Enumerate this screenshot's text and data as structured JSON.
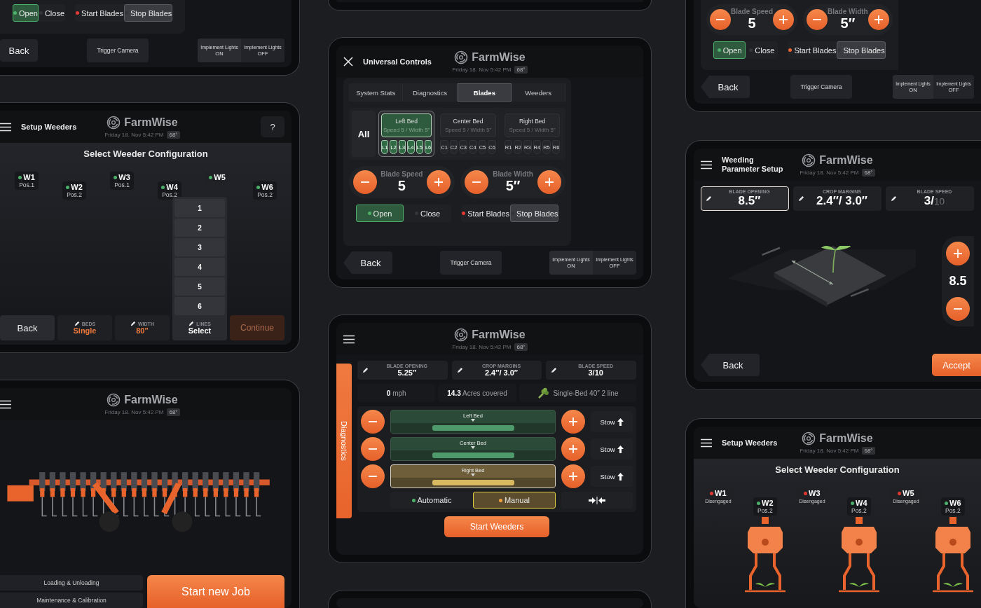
{
  "columns": [
    {
      "screens": [
        {
          "kind": "controls",
          "blocks": [
            {
              "kind": "toggles",
              "groups": [
                {
                  "kind": "positive",
                  "items": [
                    {
                      "label": "Open",
                      "color": "#4caf6a",
                      "selected": true
                    },
                    {
                      "label": "Close",
                      "color": "#34353a",
                      "selected": false
                    }
                  ]
                },
                {
                  "kind": "neutral",
                  "items": [
                    {
                      "label": "Start Blades",
                      "color": "#e53935",
                      "selected": false
                    },
                    {
                      "label": "Stop Blades",
                      "color": "#34353a",
                      "selected": true
                    }
                  ]
                }
              ]
            },
            {
              "kind": "footer",
              "back": "Back",
              "camera": "Trigger Camera",
              "lights": [
                {
                  "caption": "Implement Lights",
                  "state": "ON"
                },
                {
                  "caption": "Implement Lights",
                  "state": "OFF"
                }
              ]
            }
          ]
        },
        {
          "kind": "setup",
          "header": {
            "kind": "menu",
            "title": "Setup Weeders",
            "brand": "FarmWise",
            "date": "Friday 18. Nov 5:42 PM",
            "temp": "68°",
            "help": "?"
          },
          "blocks": [
            {
              "kind": "heading",
              "text": "Select Weeder Configuration"
            },
            {
              "kind": "weeders",
              "items": [
                {
                  "name": "W1",
                  "color": "#4caf6a",
                  "status": "Pos.1",
                  "engaged": true,
                  "highlighted": false
                },
                {
                  "name": "W2",
                  "color": "#4caf6a",
                  "status": "Pos.2",
                  "engaged": true,
                  "highlighted": false
                },
                {
                  "name": "W3",
                  "color": "#4caf6a",
                  "status": "Pos.1",
                  "engaged": true,
                  "highlighted": false
                },
                {
                  "name": "W4",
                  "color": "#4caf6a",
                  "status": "Pos.2",
                  "engaged": true,
                  "highlighted": false
                },
                {
                  "name": "W5",
                  "color": "#4caf6a",
                  "highlighted": false
                },
                {
                  "name": "W6",
                  "color": "#4caf6a",
                  "status": "Pos.2",
                  "engaged": true,
                  "highlighted": false
                }
              ]
            },
            {
              "kind": "setup_bar",
              "back": "Back",
              "fields": [
                {
                  "label": "BEDS",
                  "value": "Single",
                  "filled": true,
                  "expanded": false
                },
                {
                  "label": "WIDTH",
                  "value": "80”",
                  "filled": true,
                  "expanded": false
                },
                {
                  "label": "LINES",
                  "value": "Select",
                  "filled": false,
                  "expanded": true,
                  "options": [
                    "1",
                    "2",
                    "3",
                    "4",
                    "5",
                    "6"
                  ]
                }
              ],
              "next": {
                "label": "Continue",
                "disabled": true
              }
            }
          ]
        },
        {
          "kind": "home",
          "header": {
            "kind": "menu",
            "brand": "FarmWise",
            "date": "Friday 18. Nov 5:42 PM",
            "temp": "68°"
          },
          "blocks": [
            {
              "kind": "machine"
            },
            {
              "kind": "home_actions",
              "links": [
                "Loading & Unloading",
                "Maintenance & Calibration"
              ],
              "primary": "Start new Job"
            }
          ]
        }
      ]
    },
    {
      "screens": [
        {
          "kind": "blank"
        },
        {
          "kind": "controls",
          "header": {
            "kind": "close",
            "title": "Universal Controls",
            "brand": "FarmWise",
            "date": "Friday 18. Nov 5:42 PM",
            "temp": "68°"
          },
          "blocks": [
            {
              "kind": "tabs",
              "items": [
                {
                  "label": "System Stats",
                  "selected": false
                },
                {
                  "label": "Diagnostics",
                  "selected": false
                },
                {
                  "label": "Blades",
                  "selected": true
                },
                {
                  "label": "Weeders",
                  "selected": false
                }
              ]
            },
            {
              "kind": "beds",
              "all": "All",
              "beds": [
                {
                  "name": "Left Bed",
                  "sub": "Speed 5 / Width 5”",
                  "selected": true,
                  "blades": [
                    "L1",
                    "L2",
                    "L3",
                    "L4",
                    "L5",
                    "L6"
                  ]
                },
                {
                  "name": "Center Bed",
                  "sub": "Speed 5 / Width 5”",
                  "selected": false,
                  "blades": [
                    "C1",
                    "C2",
                    "C3",
                    "C4",
                    "C5",
                    "C6"
                  ]
                },
                {
                  "name": "Right Bed",
                  "sub": "Speed 5 / Width 5”",
                  "selected": false,
                  "blades": [
                    "R1",
                    "R2",
                    "R3",
                    "R4",
                    "R5",
                    "R6"
                  ]
                }
              ]
            },
            {
              "kind": "steppers",
              "items": [
                {
                  "label": "Blade Speed",
                  "value": "5"
                },
                {
                  "label": "Blade Width",
                  "value": "5″"
                }
              ]
            },
            {
              "kind": "toggles",
              "groups": [
                {
                  "kind": "positive",
                  "items": [
                    {
                      "label": "Open",
                      "color": "#4caf6a",
                      "selected": true
                    },
                    {
                      "label": "Close",
                      "color": "#34353a",
                      "selected": false
                    }
                  ]
                },
                {
                  "kind": "neutral",
                  "items": [
                    {
                      "label": "Start Blades",
                      "color": "#e53935",
                      "selected": false
                    },
                    {
                      "label": "Stop Blades",
                      "color": "#34353a",
                      "selected": true
                    }
                  ]
                }
              ]
            },
            {
              "kind": "footer",
              "back": "Back",
              "camera": "Trigger Camera",
              "lights": [
                {
                  "caption": "Implement Lights",
                  "state": "ON"
                },
                {
                  "caption": "Implement Lights",
                  "state": "OFF"
                }
              ]
            }
          ]
        },
        {
          "kind": "diagnostics",
          "header": {
            "kind": "menu",
            "brand": "FarmWise",
            "date": "Friday 18. Nov 5:42 PM",
            "temp": "68°"
          },
          "side_tab": "Diagnostics",
          "blocks": [
            {
              "kind": "params",
              "items": [
                {
                  "label": "BLADE OPENING",
                  "value": "5.25″",
                  "selected": false
                },
                {
                  "label": "CROP MARGINS",
                  "value": "2.4″/ 3.0″",
                  "selected": false
                },
                {
                  "label": "BLADE SPEED",
                  "value": "3/10",
                  "selected": false
                }
              ]
            },
            {
              "kind": "stats",
              "items": [
                {
                  "kind": "text",
                  "text": "**0** mph"
                },
                {
                  "kind": "text",
                  "text": "**14.3** Acres covered"
                },
                {
                  "kind": "crop",
                  "text": "Single-Bed 40″ 2 line"
                }
              ]
            },
            {
              "kind": "bed_rows",
              "rows": [
                {
                  "name": "Left Bed",
                  "selected": false,
                  "stow": "Stow"
                },
                {
                  "name": "Center Bed",
                  "selected": false,
                  "stow": "Stow"
                },
                {
                  "name": "Right Bed",
                  "selected": true,
                  "stow": "Stow"
                }
              ],
              "modes": [
                {
                  "label": "Automatic",
                  "color": "#4caf6a",
                  "selected": false
                },
                {
                  "label": "Manual",
                  "color": "#f0a040",
                  "selected": true
                }
              ]
            },
            {
              "kind": "start",
              "label": "Start Weeders"
            }
          ]
        },
        {
          "kind": "blank"
        }
      ]
    },
    {
      "screens": [
        {
          "kind": "controls",
          "blocks": [
            {
              "kind": "steppers",
              "items": [
                {
                  "label": "Blade Speed",
                  "value": "5"
                },
                {
                  "label": "Blade Width",
                  "value": "5″"
                }
              ]
            },
            {
              "kind": "toggles",
              "groups": [
                {
                  "kind": "positive",
                  "items": [
                    {
                      "label": "Open",
                      "color": "#4caf6a",
                      "selected": true
                    },
                    {
                      "label": "Close",
                      "color": "#34353a",
                      "selected": false
                    }
                  ]
                },
                {
                  "kind": "neutral",
                  "items": [
                    {
                      "label": "Start Blades",
                      "color": "#f0622f",
                      "selected": false
                    },
                    {
                      "label": "Stop Blades",
                      "color": "#34353a",
                      "selected": true
                    }
                  ]
                }
              ]
            },
            {
              "kind": "footer",
              "back": "Back",
              "camera": "Trigger Camera",
              "lights": [
                {
                  "caption": "Implement Lights",
                  "state": "ON"
                },
                {
                  "caption": "Implement Lights",
                  "state": "OFF"
                }
              ]
            }
          ]
        },
        {
          "kind": "params_setup",
          "header": {
            "kind": "menu",
            "title": "Weeding Parameter Setup",
            "brand": "FarmWise",
            "date": "Friday 18. Nov 5:42 PM",
            "temp": "68°"
          },
          "blocks": [
            {
              "kind": "params",
              "items": [
                {
                  "label": "BLADE OPENING",
                  "value": "8.5″",
                  "selected": true
                },
                {
                  "label": "CROP MARGINS",
                  "value": "2.4″/ 3.0″",
                  "selected": false
                },
                {
                  "label": "BLADE SPEED",
                  "value": "3/",
                  "suffix": "10",
                  "selected": false
                }
              ]
            },
            {
              "kind": "scene",
              "value": "8.5"
            },
            {
              "kind": "accept_bar",
              "back": "Back",
              "accept": "Accept"
            }
          ]
        },
        {
          "kind": "setup",
          "header": {
            "kind": "menu",
            "title": "Setup Weeders",
            "brand": "FarmWise",
            "date": "Friday 18. Nov 5:42 PM",
            "temp": "68°"
          },
          "blocks": [
            {
              "kind": "heading",
              "text": "Select Weeder Configuration"
            },
            {
              "kind": "weeders",
              "items": [
                {
                  "name": "W1",
                  "color": "#e53935",
                  "status": "Disengaged",
                  "engaged": false,
                  "highlighted": false
                },
                {
                  "name": "W2",
                  "color": "#4caf6a",
                  "status": "Pos.2",
                  "engaged": true,
                  "highlighted": true
                },
                {
                  "name": "W3",
                  "color": "#e53935",
                  "status": "Disengaged",
                  "engaged": false,
                  "highlighted": false
                },
                {
                  "name": "W4",
                  "color": "#4caf6a",
                  "status": "Pos.2",
                  "engaged": true,
                  "highlighted": true
                },
                {
                  "name": "W5",
                  "color": "#e53935",
                  "status": "Disengaged",
                  "engaged": false,
                  "highlighted": false
                },
                {
                  "name": "W6",
                  "color": "#4caf6a",
                  "status": "Pos.2",
                  "engaged": true,
                  "highlighted": true
                }
              ]
            }
          ]
        }
      ]
    }
  ]
}
